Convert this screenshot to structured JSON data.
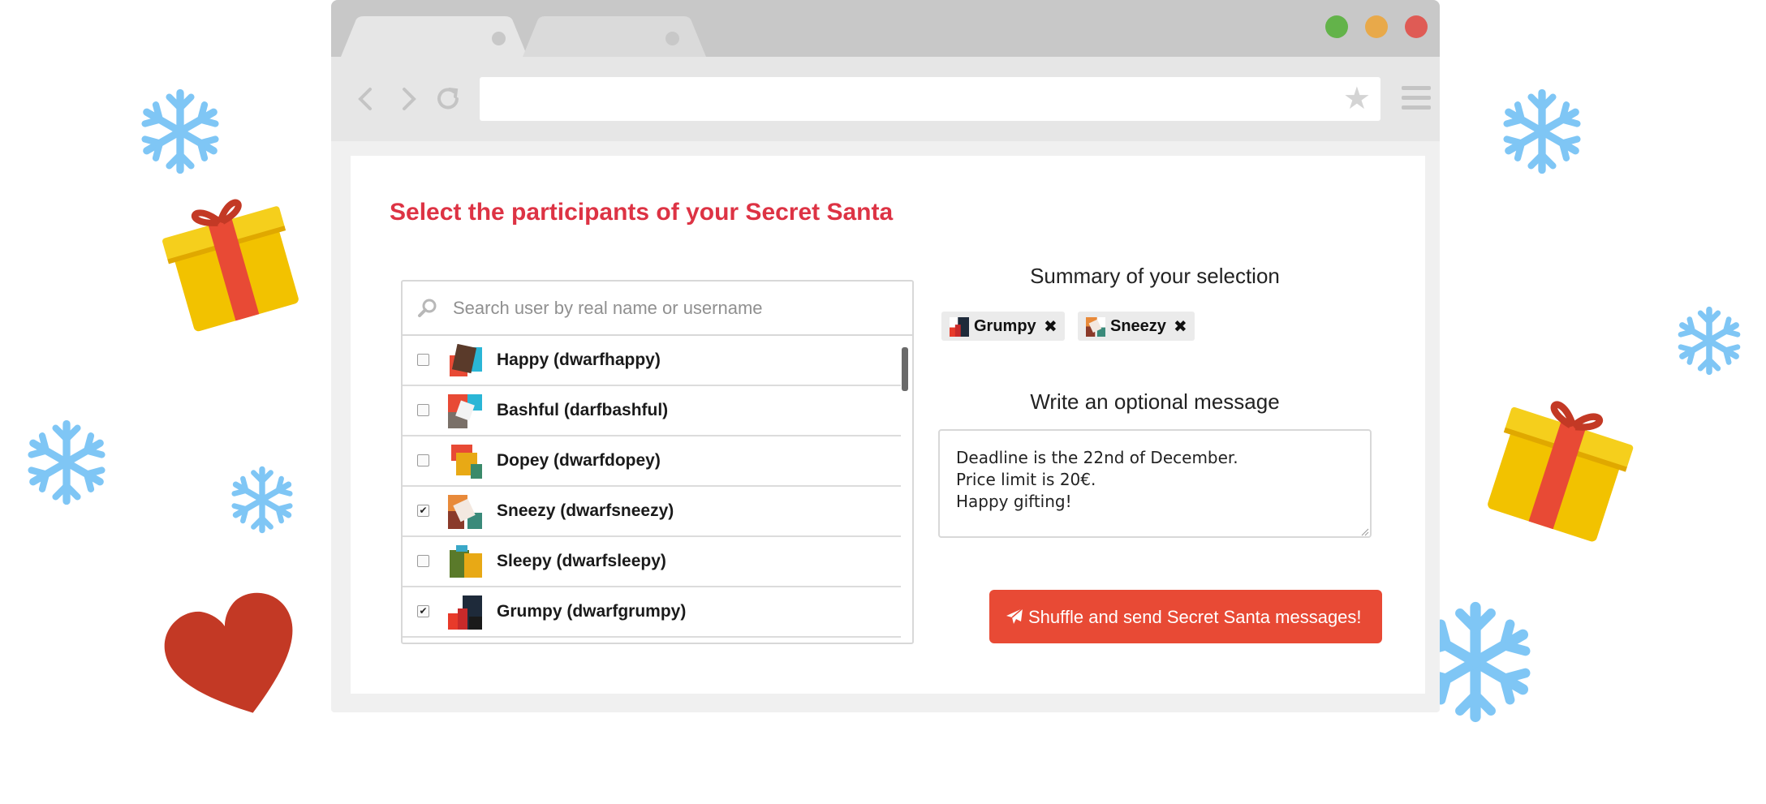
{
  "page": {
    "title": "Select the participants of your Secret Santa"
  },
  "search": {
    "placeholder": "Search user by real name or username"
  },
  "users": [
    {
      "label": "Happy (dwarfhappy)",
      "checked": false
    },
    {
      "label": "Bashful (darfbashful)",
      "checked": false
    },
    {
      "label": "Dopey (dwarfdopey)",
      "checked": false
    },
    {
      "label": "Sneezy (dwarfsneezy)",
      "checked": true
    },
    {
      "label": "Sleepy (dwarfsleepy)",
      "checked": false
    },
    {
      "label": "Grumpy (dwarfgrumpy)",
      "checked": true
    }
  ],
  "summary": {
    "heading": "Summary of your selection",
    "chips": [
      {
        "label": "Grumpy"
      },
      {
        "label": "Sneezy"
      }
    ]
  },
  "message": {
    "heading": "Write an optional message",
    "value": "Deadline is the 22nd of December.\nPrice limit is 20€.\nHappy gifting!"
  },
  "send_button": {
    "label": "Shuffle and send Secret Santa messages!",
    "icon": "paper-plane-icon"
  },
  "colors": {
    "title": "#dd3344",
    "button": "#e84a35",
    "snowflake": "#7fc6f5",
    "gift_box": "#f2c200",
    "gift_ribbon": "#e84a35",
    "heart": "#c33925",
    "window_green": "#63b34a",
    "window_yellow": "#e8a94a",
    "window_red": "#df5b55"
  }
}
